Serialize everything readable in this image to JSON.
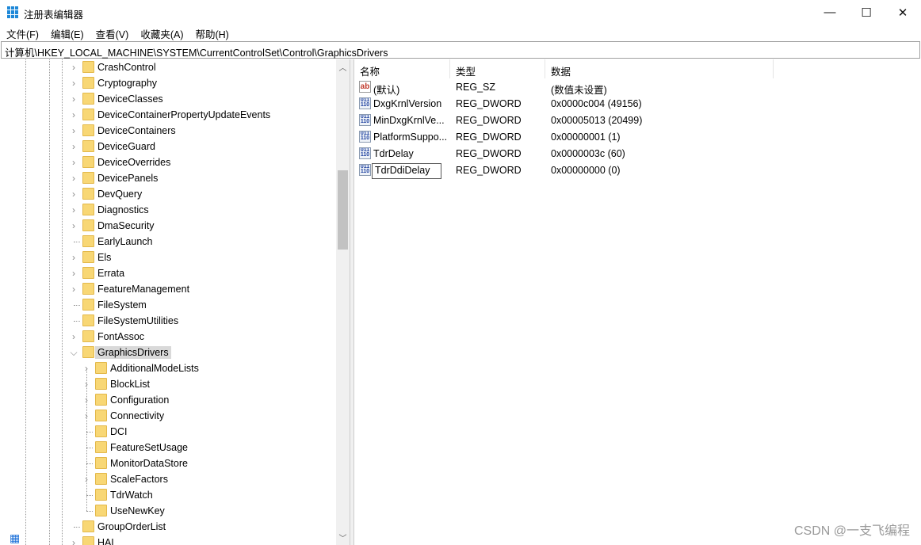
{
  "window": {
    "title": "注册表编辑器",
    "minimize": "—",
    "maximize": "☐",
    "close": "✕"
  },
  "menu": [
    "文件(F)",
    "编辑(E)",
    "查看(V)",
    "收藏夹(A)",
    "帮助(H)"
  ],
  "address": "计算机\\HKEY_LOCAL_MACHINE\\SYSTEM\\CurrentControlSet\\Control\\GraphicsDrivers",
  "tree": [
    {
      "label": "CrashControl",
      "level": 1,
      "expandable": true
    },
    {
      "label": "Cryptography",
      "level": 1,
      "expandable": true
    },
    {
      "label": "DeviceClasses",
      "level": 1,
      "expandable": true
    },
    {
      "label": "DeviceContainerPropertyUpdateEvents",
      "level": 1,
      "expandable": true
    },
    {
      "label": "DeviceContainers",
      "level": 1,
      "expandable": true
    },
    {
      "label": "DeviceGuard",
      "level": 1,
      "expandable": true
    },
    {
      "label": "DeviceOverrides",
      "level": 1,
      "expandable": true
    },
    {
      "label": "DevicePanels",
      "level": 1,
      "expandable": true
    },
    {
      "label": "DevQuery",
      "level": 1,
      "expandable": true
    },
    {
      "label": "Diagnostics",
      "level": 1,
      "expandable": true
    },
    {
      "label": "DmaSecurity",
      "level": 1,
      "expandable": true
    },
    {
      "label": "EarlyLaunch",
      "level": 1,
      "expandable": false
    },
    {
      "label": "Els",
      "level": 1,
      "expandable": true
    },
    {
      "label": "Errata",
      "level": 1,
      "expandable": true
    },
    {
      "label": "FeatureManagement",
      "level": 1,
      "expandable": true
    },
    {
      "label": "FileSystem",
      "level": 1,
      "expandable": false
    },
    {
      "label": "FileSystemUtilities",
      "level": 1,
      "expandable": false
    },
    {
      "label": "FontAssoc",
      "level": 1,
      "expandable": true
    },
    {
      "label": "GraphicsDrivers",
      "level": 1,
      "expandable": true,
      "expanded": true,
      "selected": true
    },
    {
      "label": "AdditionalModeLists",
      "level": 2,
      "expandable": true
    },
    {
      "label": "BlockList",
      "level": 2,
      "expandable": true
    },
    {
      "label": "Configuration",
      "level": 2,
      "expandable": true
    },
    {
      "label": "Connectivity",
      "level": 2,
      "expandable": true
    },
    {
      "label": "DCI",
      "level": 2,
      "expandable": false
    },
    {
      "label": "FeatureSetUsage",
      "level": 2,
      "expandable": false
    },
    {
      "label": "MonitorDataStore",
      "level": 2,
      "expandable": false
    },
    {
      "label": "ScaleFactors",
      "level": 2,
      "expandable": true
    },
    {
      "label": "TdrWatch",
      "level": 2,
      "expandable": false
    },
    {
      "label": "UseNewKey",
      "level": 2,
      "expandable": false
    },
    {
      "label": "GroupOrderList",
      "level": 1,
      "expandable": false
    },
    {
      "label": "HAL",
      "level": 1,
      "expandable": true
    }
  ],
  "columns": {
    "name": "名称",
    "type": "类型",
    "data": "数据"
  },
  "values": [
    {
      "icon": "ab",
      "name": "(默认)",
      "type": "REG_SZ",
      "data": "(数值未设置)"
    },
    {
      "icon": "bin",
      "name": "DxgKrnlVersion",
      "type": "REG_DWORD",
      "data": "0x0000c004 (49156)"
    },
    {
      "icon": "bin",
      "name": "MinDxgKrnlVe...",
      "type": "REG_DWORD",
      "data": "0x00005013 (20499)"
    },
    {
      "icon": "bin",
      "name": "PlatformSuppo...",
      "type": "REG_DWORD",
      "data": "0x00000001 (1)"
    },
    {
      "icon": "bin",
      "name": "TdrDelay",
      "type": "REG_DWORD",
      "data": "0x0000003c (60)"
    },
    {
      "icon": "bin",
      "name": "TdrDdiDelay",
      "type": "REG_DWORD",
      "data": "0x00000000 (0)",
      "editing": true
    }
  ],
  "watermark": "CSDN @一支飞编程"
}
